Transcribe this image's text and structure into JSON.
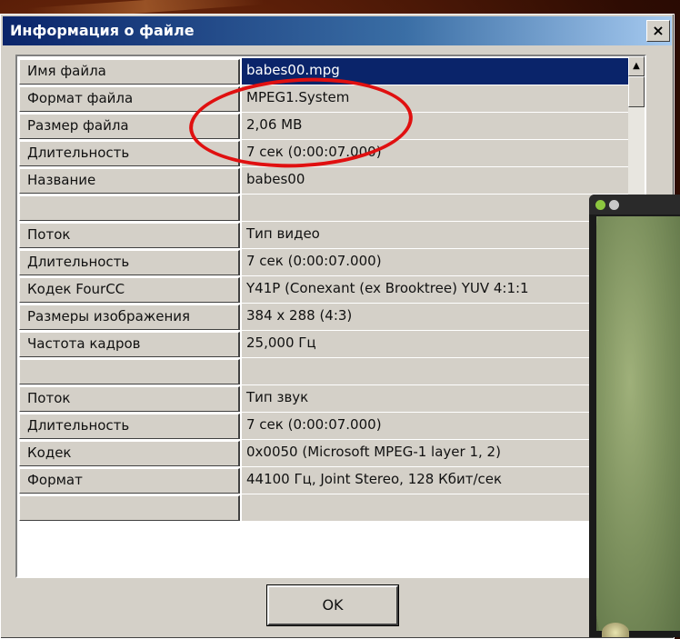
{
  "dialog": {
    "title": "Информация о файле",
    "close_symbol": "×",
    "ok_label": "OK"
  },
  "rows": [
    {
      "label": "Имя файла",
      "value": "babes00.mpg",
      "selected": true
    },
    {
      "label": "Формат файла",
      "value": "MPEG1.System"
    },
    {
      "label": "Размер файла",
      "value": "2,06 MB"
    },
    {
      "label": "Длительность",
      "value": "7 сек (0:00:07.000)"
    },
    {
      "label": "Название",
      "value": "babes00"
    },
    {
      "label": "",
      "value": ""
    },
    {
      "label": "Поток",
      "value": "Тип видео"
    },
    {
      "label": "Длительность",
      "value": "7 сек (0:00:07.000)"
    },
    {
      "label": "Кодек FourCC",
      "value": "Y41P (Conexant (ex Brooktree) YUV 4:1:1"
    },
    {
      "label": "Размеры изображения",
      "value": "384 x 288 (4:3)"
    },
    {
      "label": "Частота кадров",
      "value": "25,000 Гц"
    },
    {
      "label": "",
      "value": ""
    },
    {
      "label": "Поток",
      "value": "Тип звук"
    },
    {
      "label": "Длительность",
      "value": "7 сек (0:00:07.000)"
    },
    {
      "label": "Кодек",
      "value": "0x0050 (Microsoft MPEG-1 layer 1, 2)"
    },
    {
      "label": "Формат",
      "value": "44100 Гц, Joint Stereo, 128 Кбит/сек"
    },
    {
      "label": "",
      "value": ""
    }
  ],
  "scrollbar": {
    "up_arrow": "▲"
  },
  "annotation": {
    "color": "#e01010",
    "shape": "ellipse"
  },
  "player": {
    "dot_colors": [
      "#8cc63f",
      "#c8c8c8"
    ]
  },
  "colors": {
    "dialog_bg": "#d4d0c8",
    "title_bar": "#0a246a",
    "selection": "#0a246a"
  }
}
